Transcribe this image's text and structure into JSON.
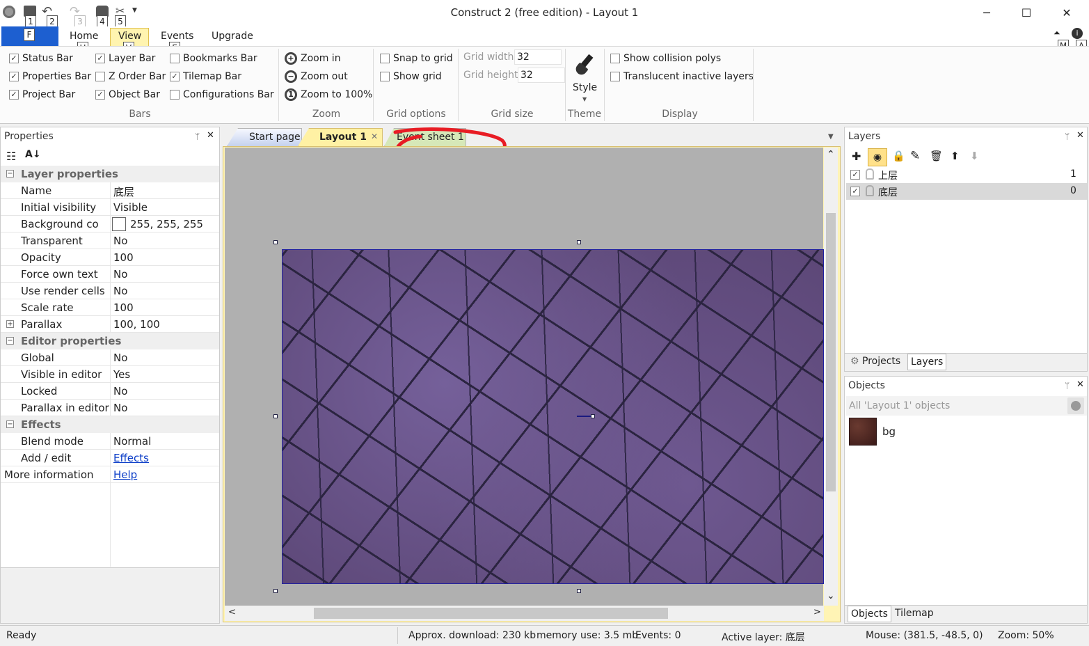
{
  "window": {
    "title": "Construct 2  (free edition) - Layout 1",
    "minimize": "─",
    "maximize": "☐",
    "close": "✕"
  },
  "qat": {
    "keys": [
      "1",
      "2",
      "3",
      "4",
      "5"
    ],
    "file_key": "F",
    "home_key": "H",
    "view_key": "V",
    "events_key": "E",
    "help_keys": [
      "M",
      "A"
    ]
  },
  "ribbon": {
    "tabs": [
      "Home",
      "View",
      "Events",
      "Upgrade"
    ],
    "bars": {
      "items": [
        {
          "label": "Status Bar",
          "checked": "✓"
        },
        {
          "label": "Layer Bar",
          "checked": "✓"
        },
        {
          "label": "Bookmarks Bar",
          "checked": ""
        },
        {
          "label": "Properties Bar",
          "checked": "✓"
        },
        {
          "label": "Z Order Bar",
          "checked": ""
        },
        {
          "label": "Tilemap Bar",
          "checked": "✓"
        },
        {
          "label": "Project Bar",
          "checked": "✓"
        },
        {
          "label": "Object Bar",
          "checked": "✓"
        },
        {
          "label": "Configurations Bar",
          "checked": ""
        }
      ],
      "group": "Bars"
    },
    "zoom": {
      "in": "Zoom in",
      "out": "Zoom out",
      "reset": "Zoom to 100%",
      "group": "Zoom",
      "in_sym": "+",
      "out_sym": "−",
      "reset_sym": "1"
    },
    "grid_options": {
      "snap": "Snap to grid",
      "show": "Show grid",
      "group": "Grid options"
    },
    "grid_size": {
      "width_label": "Grid width",
      "width": "32",
      "height_label": "Grid height",
      "height": "32",
      "group": "Grid size"
    },
    "theme": {
      "style": "Style",
      "arrow": "▼",
      "group": "Theme"
    },
    "display": {
      "collision": "Show collision polys",
      "translucent": "Translucent inactive layers",
      "group": "Display"
    }
  },
  "properties": {
    "title": "Properties",
    "pin": "ᛘ",
    "close": "✕",
    "sections": [
      {
        "label": "Layer properties",
        "sym": "−"
      },
      {
        "label": "Editor properties",
        "sym": "−"
      },
      {
        "label": "Effects",
        "sym": "−"
      }
    ],
    "rows": [
      {
        "k": "Name",
        "v": "底层"
      },
      {
        "k": "Initial visibility",
        "v": "Visible"
      },
      {
        "k": "Background co",
        "v": "255, 255, 255"
      },
      {
        "k": "Transparent",
        "v": "No"
      },
      {
        "k": "Opacity",
        "v": "100"
      },
      {
        "k": "Force own text",
        "v": "No"
      },
      {
        "k": "Use render cells",
        "v": "No"
      },
      {
        "k": "Scale rate",
        "v": "100"
      },
      {
        "k": "Parallax",
        "v": "100, 100"
      },
      {
        "k": "Global",
        "v": "No"
      },
      {
        "k": "Visible in editor",
        "v": "Yes"
      },
      {
        "k": "Locked",
        "v": "No"
      },
      {
        "k": "Parallax in editor",
        "v": "No"
      },
      {
        "k": "Blend mode",
        "v": "Normal"
      },
      {
        "k": "Add / edit",
        "v": "Effects"
      },
      {
        "k": "More information",
        "v": "Help"
      }
    ],
    "plus": "+"
  },
  "doc_tabs": {
    "start": "Start page",
    "layout": "Layout 1",
    "event": "Event sheet 1",
    "close": "✕",
    "menu": "▼"
  },
  "scroll": {
    "up": "⌃",
    "down": "⌄",
    "left": "<",
    "right": ">"
  },
  "layers": {
    "title": "Layers",
    "pin": "ᛘ",
    "close": "✕",
    "tools": [
      "✚",
      "👁",
      "🔒",
      "✎",
      "🗑",
      "⬆",
      "⬇"
    ],
    "items": [
      {
        "name": "上层",
        "idx": "1"
      },
      {
        "name": "底层",
        "idx": "0"
      }
    ],
    "tabs": [
      "Projects",
      "Layers"
    ],
    "check": "✓"
  },
  "objects": {
    "title": "Objects",
    "pin": "ᛘ",
    "close": "✕",
    "filter": "All 'Layout 1' objects",
    "item": "bg",
    "tabs": [
      "Objects",
      "Tilemap"
    ]
  },
  "status": {
    "ready": "Ready",
    "download": "Approx. download: 230 kb",
    "memory": "memory use: 3.5 mb",
    "events": "Events: 0",
    "active": "Active layer: 底层",
    "mouse": "Mouse: (381.5, -48.5, 0)",
    "zoom": "Zoom: 50%"
  }
}
